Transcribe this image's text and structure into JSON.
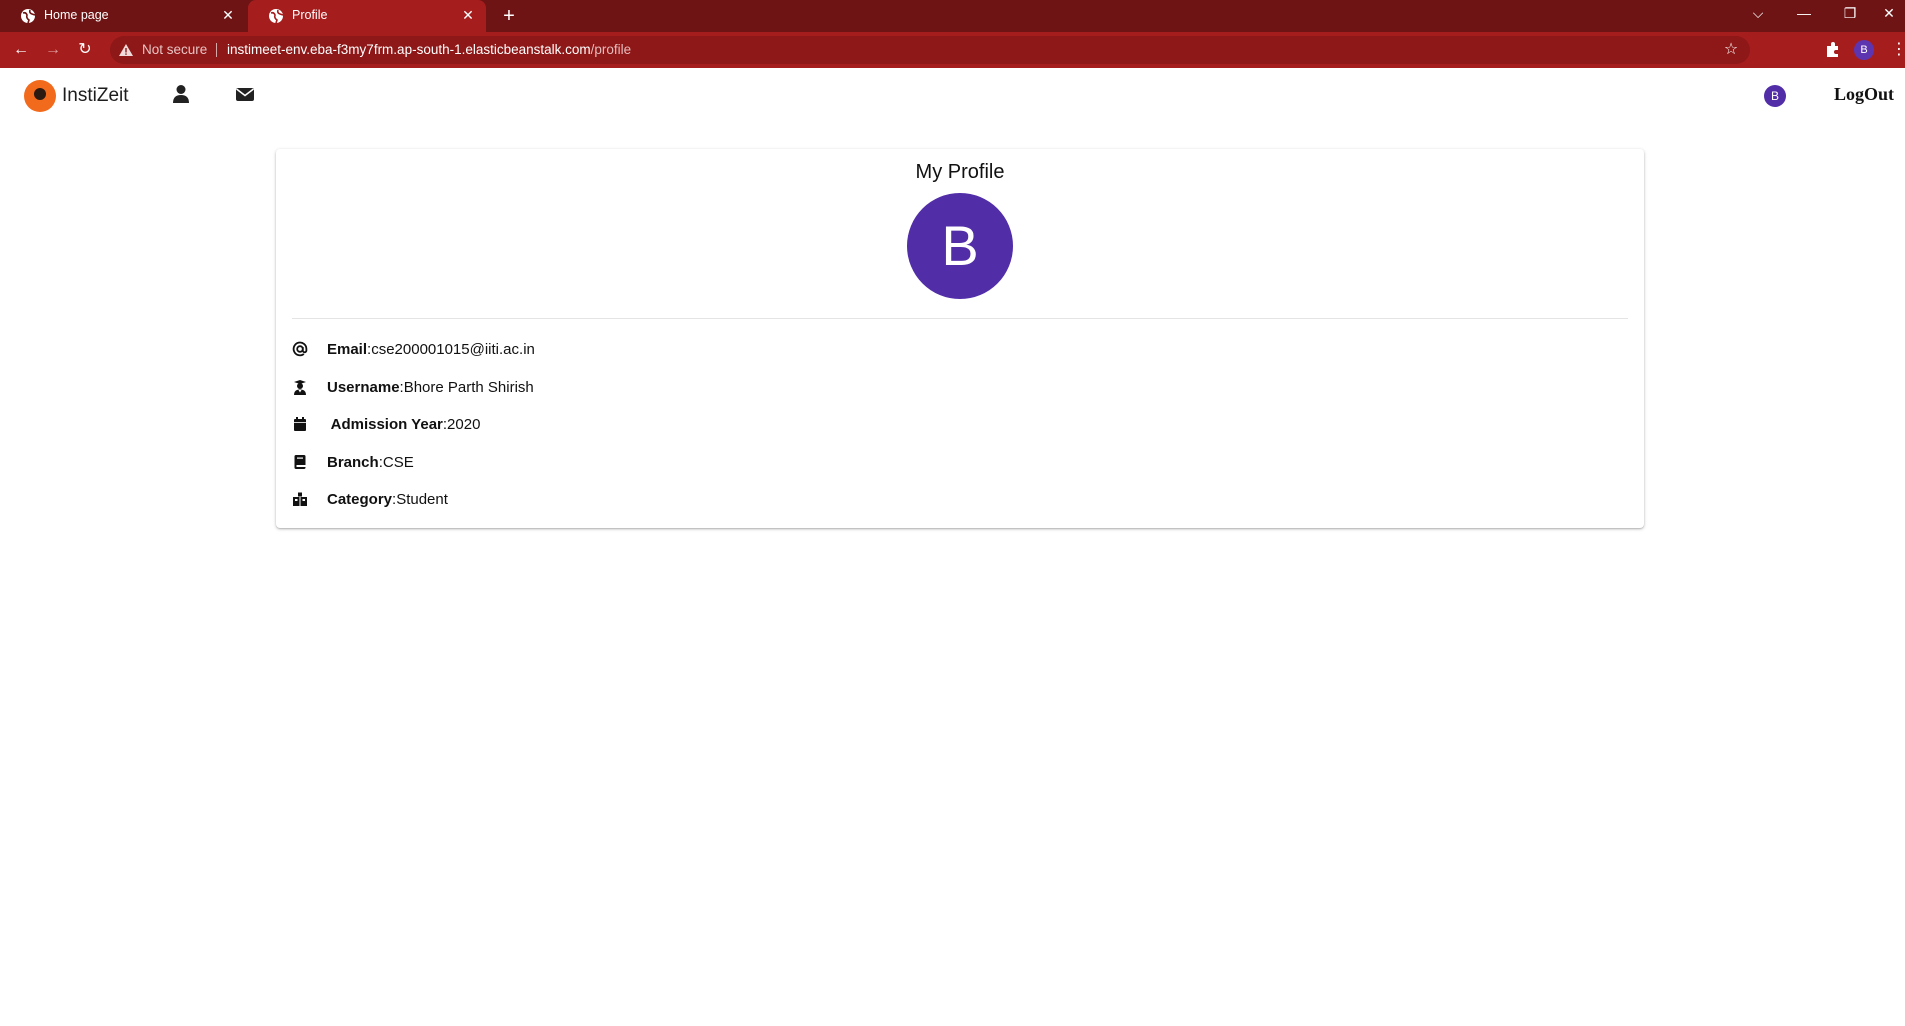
{
  "browser": {
    "tabs": [
      {
        "title": "Home page",
        "active": false
      },
      {
        "title": "Profile",
        "active": true
      }
    ],
    "new_tab_symbol": "+",
    "security_label": "Not secure",
    "url_host": "instimeet-env.eba-f3my7frm.ap-south-1.elasticbeanstalk.com",
    "url_path": "/profile",
    "profile_initial": "B"
  },
  "nav": {
    "brand": "InstiZeit",
    "avatar_initial": "B",
    "logout_label": "LogOut",
    "icons": [
      "user-icon",
      "envelope-icon"
    ]
  },
  "profile": {
    "title": "My Profile",
    "avatar_initial": "B",
    "avatar_color": "#512da8",
    "fields": [
      {
        "icon": "at-icon",
        "label": "Email",
        "value": ":cse200001015@iiti.ac.in"
      },
      {
        "icon": "user-graduate-icon",
        "label": "Username",
        "value": ":Bhore Parth Shirish"
      },
      {
        "icon": "calendar-icon",
        "label": " Admission Year",
        "value": ":2020"
      },
      {
        "icon": "book-icon",
        "label": "Branch",
        "value": ":CSE"
      },
      {
        "icon": "school-icon",
        "label": "Category",
        "value": ":Student"
      }
    ]
  },
  "colors": {
    "tabstrip": "#6e1414",
    "toolbar": "#a61d1d",
    "brand_logo": "#f26a1b"
  }
}
